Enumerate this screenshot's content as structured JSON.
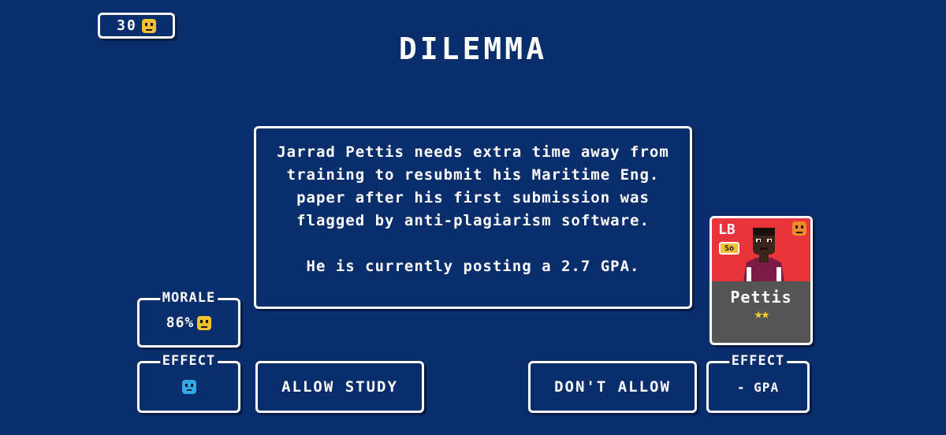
{
  "counter": {
    "value": "30",
    "icon": "coin-face-icon"
  },
  "title": "DILEMMA",
  "dialog": {
    "body": "Jarrad Pettis needs extra time away from training to resubmit his Maritime Eng. paper after his first submission was flagged by anti-plagiarism software.",
    "gpa_line": "He is currently posting a 2.7 GPA."
  },
  "morale": {
    "label": "MORALE",
    "value": "86%",
    "icon": "happy-face-icon"
  },
  "effect_left": {
    "label": "EFFECT",
    "icon": "sad-face-icon"
  },
  "effect_right": {
    "label": "EFFECT",
    "value": "- GPA"
  },
  "buttons": {
    "allow": "ALLOW STUDY",
    "deny": "DON'T ALLOW"
  },
  "player": {
    "position": "LB",
    "class_badge": "So",
    "name": "Pettis",
    "stars": "★★",
    "star_count": 2
  },
  "colors": {
    "background": "#0a2d6b",
    "card_red": "#e8343b",
    "card_gray": "#555555",
    "face_yellow": "#f2c12e",
    "face_orange": "#f08a24",
    "face_blue": "#2fa7e8"
  }
}
